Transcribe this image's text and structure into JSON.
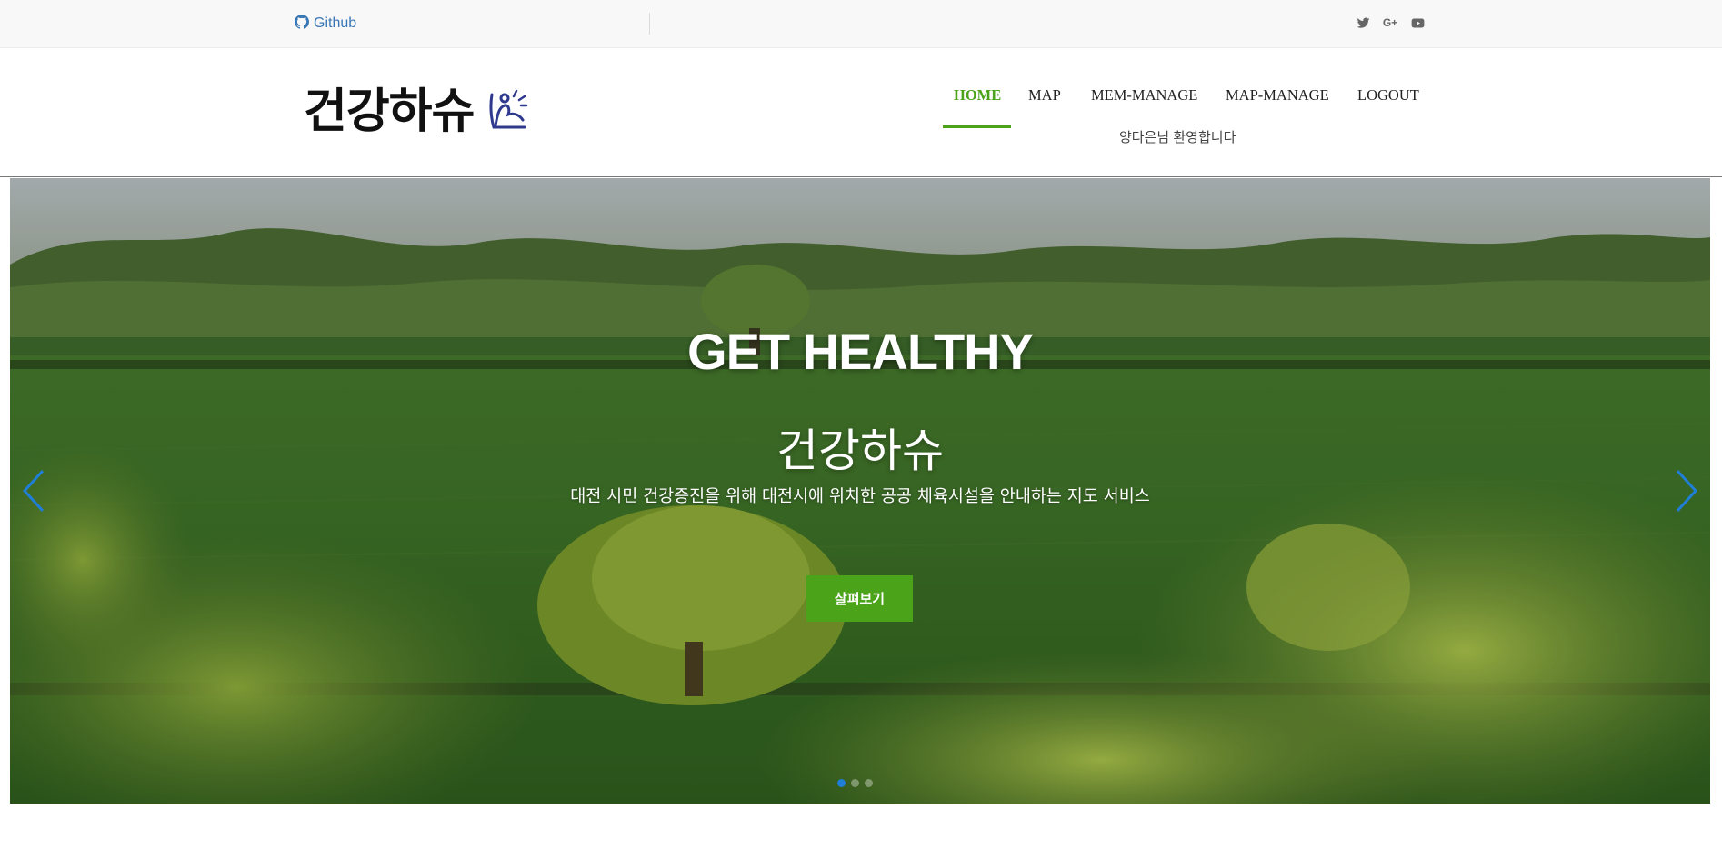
{
  "topbar": {
    "github_label": "Github"
  },
  "social": {
    "icons": [
      "twitter-icon",
      "google-plus-icon",
      "youtube-icon"
    ],
    "google_plus_text": "G+"
  },
  "header": {
    "logo_text": "건강하슈"
  },
  "nav": {
    "items": [
      {
        "label": "HOME",
        "active": true
      },
      {
        "label": "MAP",
        "active": false
      },
      {
        "label": "MEM-MANAGE",
        "active": false
      },
      {
        "label": "MAP-MANAGE",
        "active": false
      },
      {
        "label": "LOGOUT",
        "active": false
      }
    ],
    "welcome_text": "양다은님 환영합니다"
  },
  "hero": {
    "title": "GET HEALTHY",
    "subtitle": "건강하슈",
    "description": "대전 시민 건강증진을 위해 대전시에 위치한 공공 체육시설을 안내하는 지도 서비스",
    "button_label": "살펴보기",
    "slide_count": 3,
    "active_slide": 1
  },
  "colors": {
    "accent": "#4aa319",
    "link": "#3a78b5",
    "carousel_control": "#1f7fd6"
  }
}
